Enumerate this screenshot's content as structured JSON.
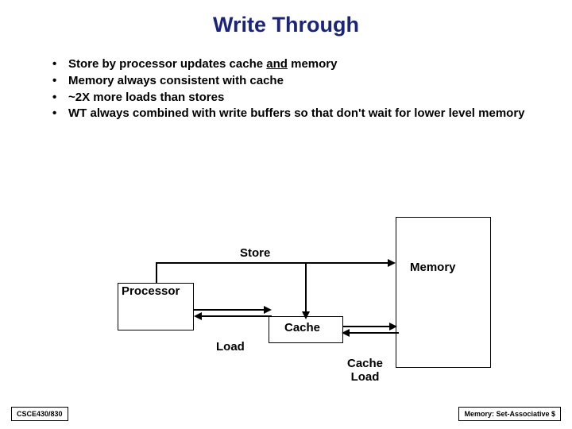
{
  "title": "Write Through",
  "bullets": [
    {
      "pre": "Store by processor updates cache ",
      "u": "and",
      "post": " memory"
    },
    {
      "pre": "Memory always consistent with cache",
      "u": "",
      "post": ""
    },
    {
      "pre": "~2X more loads than stores",
      "u": "",
      "post": ""
    },
    {
      "pre": "WT always combined with write buffers so that don't wait for lower level memory",
      "u": "",
      "post": ""
    }
  ],
  "diagram": {
    "processor": "Processor",
    "cache": "Cache",
    "memory": "Memory",
    "store": "Store",
    "load": "Load",
    "cache_load": "Cache\nLoad"
  },
  "footer": {
    "left": "CSCE430/830",
    "right": "Memory: Set-Associative $"
  }
}
